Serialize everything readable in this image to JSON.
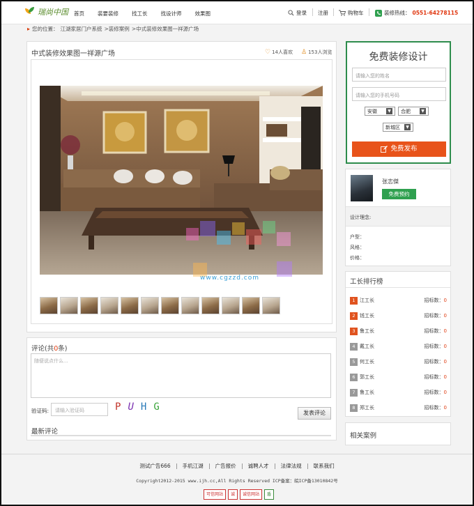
{
  "header": {
    "logo_text": "瑞尚中国",
    "nav": [
      "首页",
      "装要装修",
      "找工长",
      "找设计师",
      "效果图"
    ],
    "login": "登录",
    "register": "注册",
    "cart": "购物车",
    "hotline_label": "装修热线：",
    "hotline": "0551-64278115"
  },
  "breadcrumb": {
    "prefix": "您的位置：",
    "items": [
      "江湖家居门户系统",
      ">装修案例",
      ">中式装修效果图一祥源广场"
    ]
  },
  "case": {
    "title": "中式装修效果图一祥源广场",
    "likes": "14人喜欢",
    "views": "153人浏览"
  },
  "watermark": {
    "url": "www.cgzzd.com"
  },
  "comments": {
    "title_prefix": "评论(共",
    "count": "0",
    "title_suffix": "条)",
    "placeholder": "随便说点什么...",
    "captcha_label": "验证码:",
    "captcha_placeholder": "请输入验证码",
    "captcha_chars": [
      "P",
      "U",
      "H",
      "G"
    ],
    "submit": "发表评论",
    "latest_title": "最新评论"
  },
  "design_form": {
    "title": "免费装修设计",
    "name_placeholder": "请输入您的姓名",
    "phone_placeholder": "请输入您的手机号码",
    "province": "安徽",
    "city": "合肥",
    "district": "新城区",
    "submit": "免费发布"
  },
  "designer": {
    "name": "张志傑",
    "book": "免费预约",
    "concept_label": "设计理念:",
    "house_type_label": "户型：",
    "style_label": "风格：",
    "price_label": "价格："
  },
  "ranking": {
    "title": "工长排行榜",
    "bid_label": "招标数：",
    "rows": [
      {
        "rank": "1",
        "name": "江工长",
        "bids": "0"
      },
      {
        "rank": "2",
        "name": "钱工长",
        "bids": "0"
      },
      {
        "rank": "3",
        "name": "鲁工长",
        "bids": "0"
      },
      {
        "rank": "4",
        "name": "戴工长",
        "bids": "0"
      },
      {
        "rank": "5",
        "name": "何工长",
        "bids": "0"
      },
      {
        "rank": "6",
        "name": "郭工长",
        "bids": "0"
      },
      {
        "rank": "7",
        "name": "鲁工长",
        "bids": "0"
      },
      {
        "rank": "8",
        "name": "郑工长",
        "bids": "0"
      }
    ]
  },
  "related": {
    "title": "相关案例"
  },
  "footer": {
    "links": [
      "测试广告666",
      "手机江湖",
      "广告报价",
      "诚聘人才",
      "法律法规",
      "联系我们"
    ],
    "copyright": "Copyright2012-2015 www.ijh.cc,All Rights Reserved ICP备案：皖ICP备13010842号",
    "badges": [
      "可信网站",
      "诚",
      "诚信网站",
      "盾"
    ]
  },
  "colors": {
    "accent_orange": "#e8531a",
    "accent_green": "#2d8c4c",
    "price_red": "#e03d12"
  }
}
